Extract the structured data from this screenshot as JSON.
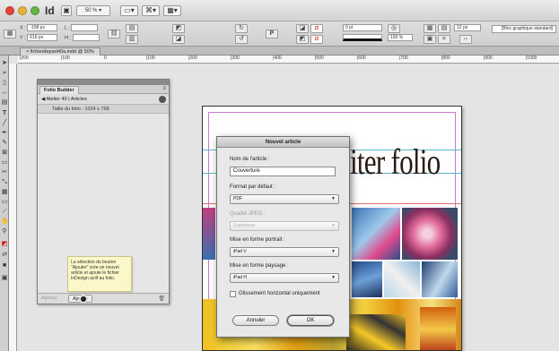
{
  "app": {
    "icon_label": "Id",
    "zoom": "50 %"
  },
  "control_panel": {
    "x_label": "X :",
    "x_value": "-108 px",
    "y_label": "Y :",
    "y_value": "616 px",
    "l_label": "L :",
    "h_label": "H :",
    "stroke_weight": "0 pt",
    "percent_value": "100 %",
    "width_value": "12 px",
    "object_style": "[Bloc graphique standard]"
  },
  "document_tab": {
    "title": "fichierdepart40a.indd @ 50%"
  },
  "ruler": {
    "labels": [
      "|200",
      "|100",
      "0",
      "|100",
      "|200",
      "|300",
      "|400",
      "|500",
      "|600",
      "|700",
      "|800",
      "|900",
      "|1000"
    ]
  },
  "folio_panel": {
    "tab_label": "Folio Builder",
    "breadcrumb": "◀ Atelier 40 | Articles",
    "folio_size": "Taille du folio : 1024 x 768",
    "tooltip": "La sélection du bouton \"Ajouter\" crée un nouvel article et ajoute le fichier InDesign actif au folio.",
    "preview_label": "Aperçu",
    "add_label": "Ajouter"
  },
  "document": {
    "headline": "iter folio"
  },
  "dialog": {
    "title": "Nouvel article",
    "name_label": "Nom de l'article :",
    "name_value": "Couverture",
    "format_label": "Format par défaut :",
    "format_value": "PDF",
    "jpeg_label": "Qualité JPEG :",
    "jpeg_value": "Supérieure",
    "portrait_label": "Mise en forme portrait :",
    "portrait_value": "iPad V",
    "landscape_label": "Mise en forme paysage :",
    "landscape_value": "iPad H",
    "horizontal_swipe_label": "Glissement horizontal uniquement",
    "cancel_label": "Annuler",
    "ok_label": "OK"
  },
  "colors": {
    "dialog_bg": "#e8e8e8",
    "tooltip_bg": "#fbf7c8",
    "guide": "#58b8d0",
    "margin": "#c77bc7"
  }
}
